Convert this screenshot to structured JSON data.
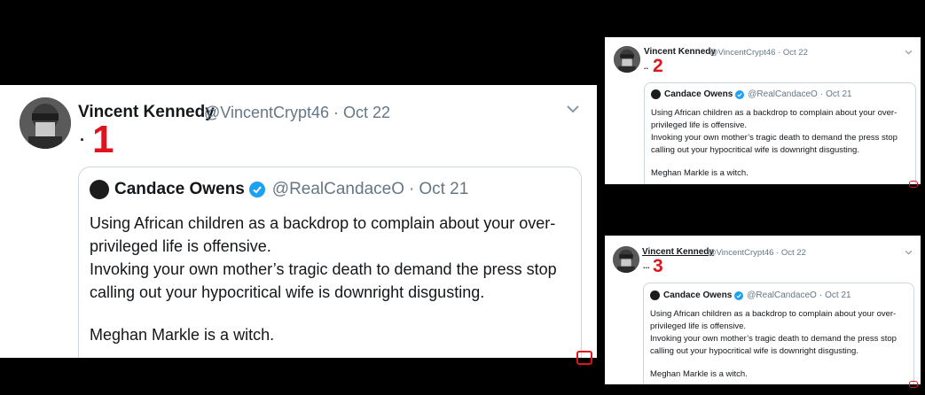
{
  "tweets": [
    {
      "author_name": "Vincent Kennedy",
      "author_handle": "@VincentCrypt46",
      "separator": "·",
      "date": "Oct 22",
      "body_dots": "·",
      "marker": "1",
      "quoted": {
        "author_name": "Candace Owens",
        "author_handle": "@RealCandaceO",
        "separator": "·",
        "date": "Oct 21",
        "line1": "Using African children as a backdrop to complain about your over-",
        "line2": "privileged life is offensive.",
        "line3": "Invoking your own mother’s tragic death to demand the press stop",
        "line4": "calling out your hypocritical wife is downright disgusting.",
        "line5": "Meghan Markle is a witch."
      }
    },
    {
      "author_name": "Vincent Kennedy",
      "author_handle": "@VincentCrypt46",
      "separator": "·",
      "date": "Oct 22",
      "body_dots": "..",
      "marker": "2",
      "quoted": {
        "author_name": "Candace Owens",
        "author_handle": "@RealCandaceO",
        "separator": "·",
        "date": "Oct 21",
        "line1": "Using African children as a backdrop to complain about your over-",
        "line2": "privileged life is offensive.",
        "line3": "Invoking your own mother’s tragic death to demand the press stop",
        "line4": "calling out your hypocritical wife is downright disgusting.",
        "line5": "Meghan Markle is a witch."
      }
    },
    {
      "author_name": "Vincent Kennedy",
      "author_handle": "@VincentCrypt46",
      "separator": "·",
      "date": "Oct 22",
      "body_dots": "...",
      "marker": "3",
      "quoted": {
        "author_name": "Candace Owens",
        "author_handle": "@RealCandaceO",
        "separator": "·",
        "date": "Oct 21",
        "line1": "Using African children as a backdrop to complain about your over-",
        "line2": "privileged life is offensive.",
        "line3": "Invoking your own mother’s tragic death to demand the press stop",
        "line4": "calling out your hypocritical wife is downright disgusting.",
        "line5": "Meghan Markle is a witch."
      }
    }
  ],
  "icons": {
    "chevron": "chevron-down-icon",
    "verified": "verified-badge-icon",
    "corner": "corner-marker-icon"
  },
  "colors": {
    "marker_red": "#e0141c",
    "verified_blue": "#1da1f2",
    "meta_gray": "#657786"
  }
}
